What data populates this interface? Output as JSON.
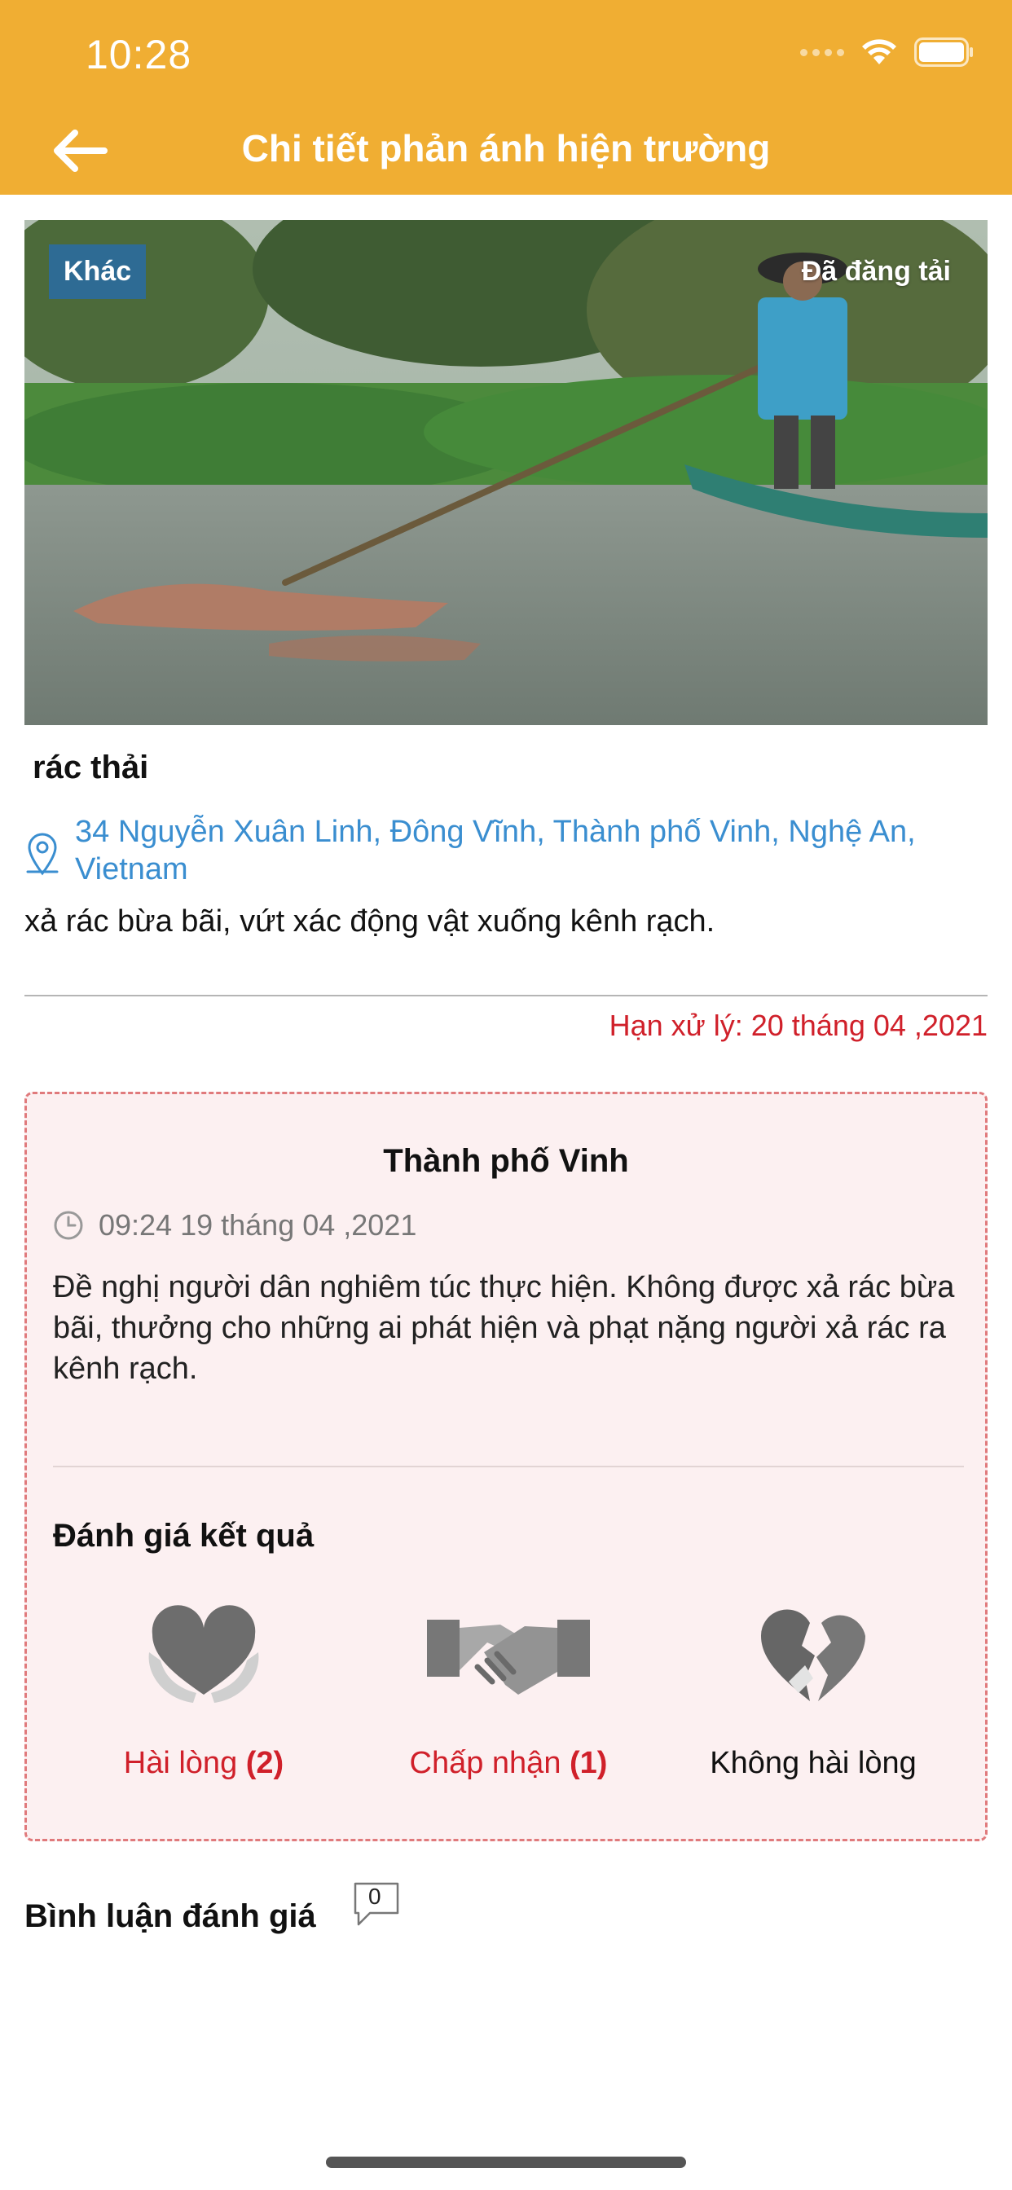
{
  "status_bar": {
    "time": "10:28"
  },
  "header": {
    "title": "Chi tiết phản ánh hiện trường"
  },
  "photo": {
    "category_tag": "Khác",
    "status_tag": "Đã đăng tải"
  },
  "report": {
    "title": "rác thải",
    "address": "34 Nguyễn Xuân Linh, Đông Vĩnh, Thành phố Vinh, Nghệ An, Vietnam",
    "description": "xả rác bừa bãi, vứt xác động vật xuống kênh rạch.",
    "deadline": "Hạn xử lý: 20 tháng 04 ,2021"
  },
  "response": {
    "org": "Thành phố Vinh",
    "time": "09:24 19 tháng 04 ,2021",
    "text": "Đề nghị người dân nghiêm túc thực hiện. Không được xả rác bừa bãi, thưởng cho những ai phát hiện và phạt nặng người xả rác ra kênh rạch."
  },
  "rating": {
    "heading": "Đánh giá kết quả",
    "options": [
      {
        "label": "Hài lòng",
        "count": "(2)",
        "icon": "heart-hands-icon"
      },
      {
        "label": "Chấp nhận",
        "count": "(1)",
        "icon": "handshake-icon"
      },
      {
        "label": "Không hài lòng",
        "count": "",
        "icon": "broken-heart-icon"
      }
    ]
  },
  "comments": {
    "label": "Bình luận đánh giá",
    "count": "0"
  },
  "colors": {
    "header": "#f0ae33",
    "tag": "#2e6b94",
    "link": "#3a8ed0",
    "alert": "#d0202a",
    "panel": "#fcf0f1"
  }
}
